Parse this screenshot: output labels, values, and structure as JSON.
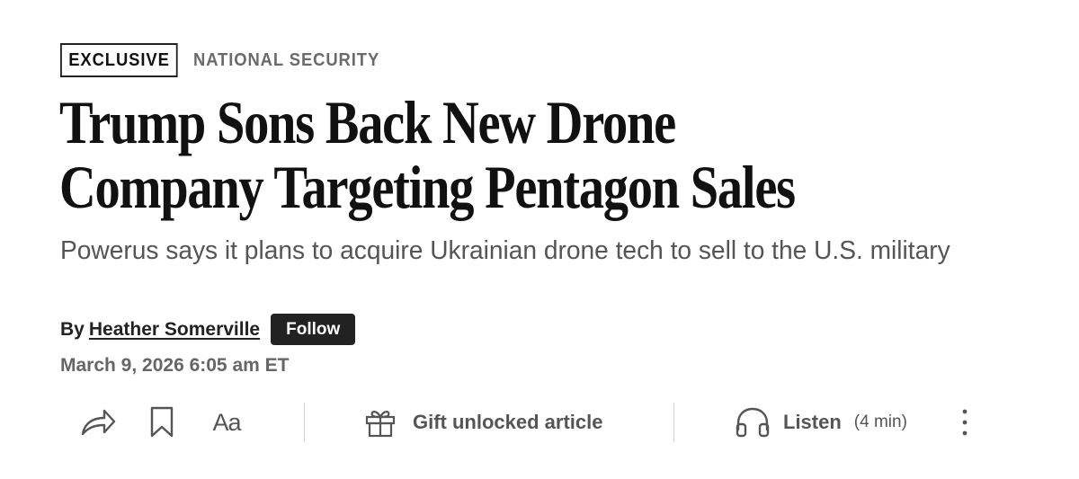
{
  "article": {
    "badge": "EXCLUSIVE",
    "section": "NATIONAL SECURITY",
    "headline": "Trump Sons Back New Drone Company Targeting Pentagon Sales",
    "dek": "Powerus says it plans to acquire Ukrainian drone tech to sell to the U.S. military",
    "byline_prefix": "By",
    "author": "Heather Somerville",
    "follow_label": "Follow",
    "timestamp": "March 9, 2026 6:05 am ET"
  },
  "toolbar": {
    "share_icon": "share-icon",
    "bookmark_icon": "bookmark-icon",
    "text_size_label": "Aa",
    "gift_icon": "gift-icon",
    "gift_label": "Gift unlocked article",
    "listen_icon": "headphones-icon",
    "listen_label": "Listen",
    "listen_duration": "(4 min)",
    "more_icon": "more-vertical-icon"
  },
  "colors": {
    "text_primary": "#111111",
    "text_secondary": "#555555",
    "section_gray": "#6a6a6a",
    "button_bg": "#222222",
    "divider": "#d4d4d4"
  }
}
